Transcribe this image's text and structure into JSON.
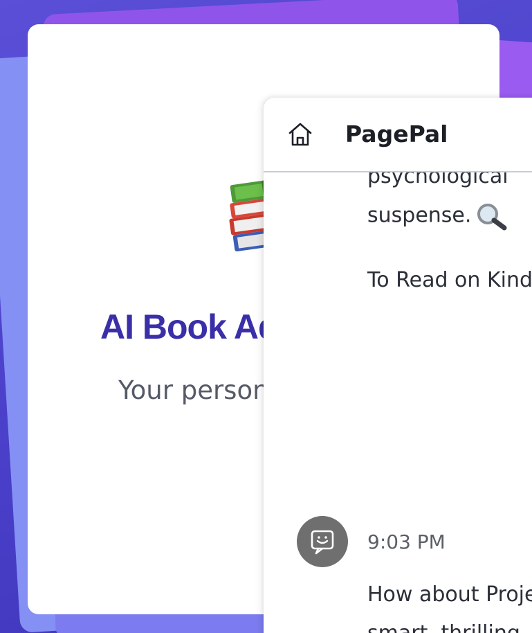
{
  "hero": {
    "title": "AI Book Advisor",
    "subtitle": "Your personal reading guide"
  },
  "chat": {
    "header": {
      "home_icon": "home-icon",
      "title": "PagePal"
    },
    "messages": [
      {
        "role": "assistant",
        "lines": [
          "psychological",
          "suspense.",
          "To Read on Kindle"
        ],
        "emoji": "magnifying-glass-icon"
      },
      {
        "role": "assistant",
        "time": "9:03 PM",
        "avatar_icon": "chat-bot-icon",
        "lines": [
          "How about Project Hail Mary",
          "smart, thrilling"
        ]
      }
    ]
  },
  "colors": {
    "background": "#4a3fc9",
    "title": "#3a2fa8",
    "avatar": "#6f6f6f"
  }
}
